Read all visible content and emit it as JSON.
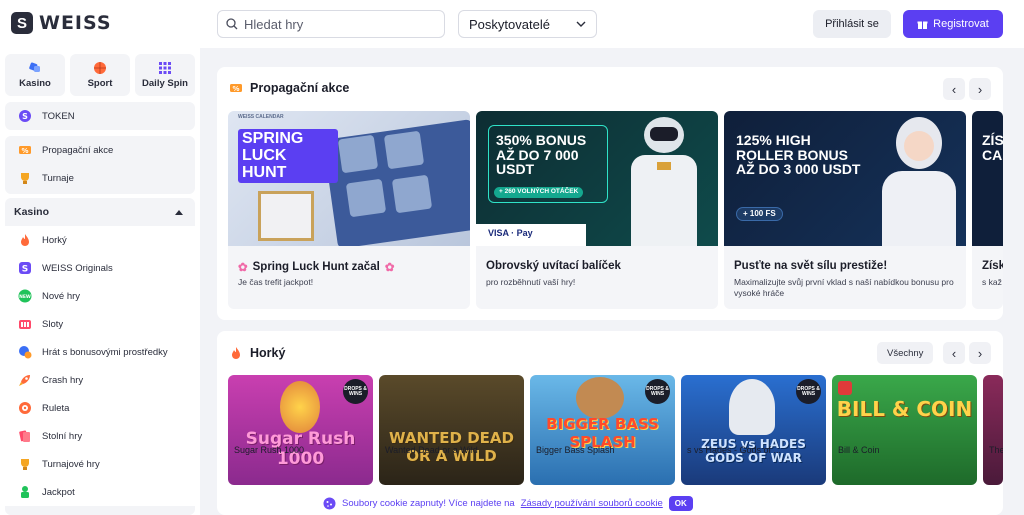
{
  "header": {
    "brand": "WEISS",
    "search_placeholder": "Hledat hry",
    "providers_label": "Poskytovatelé",
    "login_label": "Přihlásit se",
    "register_label": "Registrovat"
  },
  "sidebar": {
    "tiles": [
      {
        "label": "Kasino",
        "icon": "casino-icon"
      },
      {
        "label": "Sport",
        "icon": "basketball-icon"
      },
      {
        "label": "Daily Spin",
        "icon": "spin-grid-icon"
      }
    ],
    "token_label": "TOKEN",
    "promo_items": [
      {
        "label": "Propagační akce",
        "icon": "promo-tag-icon"
      },
      {
        "label": "Turnaje",
        "icon": "trophy-icon"
      }
    ],
    "kasino_header": "Kasino",
    "kasino_items": [
      {
        "label": "Horký",
        "icon": "fire-icon"
      },
      {
        "label": "WEISS Originals",
        "icon": "weiss-icon"
      },
      {
        "label": "Nové hry",
        "icon": "new-badge-icon"
      },
      {
        "label": "Sloty",
        "icon": "slot-icon"
      },
      {
        "label": "Hrát s bonusovými prostředky",
        "icon": "bonus-icon"
      },
      {
        "label": "Crash hry",
        "icon": "rocket-icon"
      },
      {
        "label": "Ruleta",
        "icon": "roulette-icon"
      },
      {
        "label": "Stolní hry",
        "icon": "cards-icon"
      },
      {
        "label": "Turnajové hry",
        "icon": "trophy-icon"
      },
      {
        "label": "Jackpot",
        "icon": "jackpot-icon"
      }
    ]
  },
  "promotions": {
    "title": "Propagační akce",
    "cards": [
      {
        "banner": "SPRING LUCK HUNT",
        "banner_small": "WEISS CALENDAR",
        "title": "Spring Luck Hunt začal",
        "desc": "Je čas trefit jackpot!"
      },
      {
        "banner": "350% BONUS AŽ DO 7 000 USDT",
        "banner_sub": "+ 260 VOLNÝCH OTÁČEK",
        "payments": "VISA · Pay",
        "title": "Obrovský uvítací balíček",
        "desc": "pro rozběhnutí vaší hry!"
      },
      {
        "banner": "125% HIGH ROLLER BONUS AŽ DO 3 000 USDT",
        "banner_sub": "+ 100 FS",
        "title": "Pusťte na svět sílu prestiže!",
        "desc": "Maximalizujte svůj první vklad s naší nabídkou bonusu pro vysoké hráče"
      },
      {
        "banner": "ZÍS CA",
        "title": "Získ",
        "desc": "s kaž"
      }
    ]
  },
  "hot": {
    "title": "Horký",
    "all_label": "Všechny",
    "drops_badge": "DROPS & WINS",
    "games": [
      {
        "art_title": "Sugar Rush 1000",
        "label": "Sugar Rush 1000"
      },
      {
        "art_title": "WANTED DEAD OR A WILD",
        "label": "Wanted Dead or a Wild"
      },
      {
        "art_title": "BIGGER BASS SPLASH",
        "label": "Bigger Bass Splash"
      },
      {
        "art_title": "ZEUS vs HADES GODS OF WAR",
        "label": "s vs Hades - Gods of ..."
      },
      {
        "art_title": "BILL & COIN",
        "label": "Bill & Coin"
      },
      {
        "art_title": "",
        "label": "The"
      }
    ]
  },
  "cookie": {
    "text": "Soubory cookie zapnuty! Více najdete na",
    "link": "Zásady používání souborů cookie",
    "ok": "OK"
  }
}
